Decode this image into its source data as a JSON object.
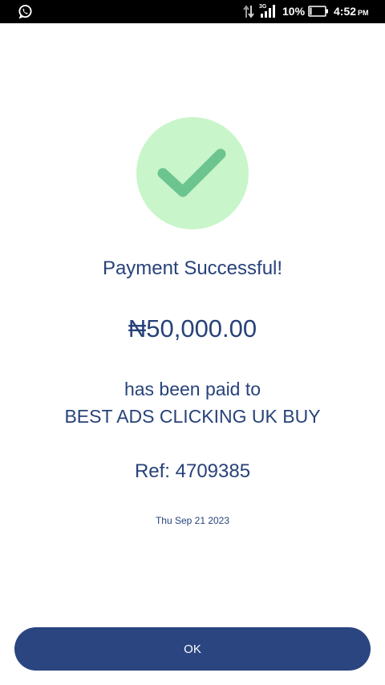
{
  "status_bar": {
    "icons": [
      "whatsapp-icon",
      "data-transfer-icon",
      "signal-3g-icon",
      "battery-icon"
    ],
    "network_label": "3G",
    "battery_percent": "10%",
    "time": "4:52",
    "ampm": "PM"
  },
  "receipt": {
    "icon": "checkmark-icon",
    "icon_bg_color": "#c8f5c9",
    "icon_color": "#6cc48f",
    "text_color": "#28427a",
    "title": "Payment Successful!",
    "amount": "₦50,000.00",
    "paid_to_label": "has been paid to",
    "merchant": "BEST ADS CLICKING UK BUY",
    "reference": "Ref: 4709385",
    "date": "Thu Sep 21 2023"
  },
  "actions": {
    "ok_label": "OK",
    "button_color": "#2a4580"
  }
}
